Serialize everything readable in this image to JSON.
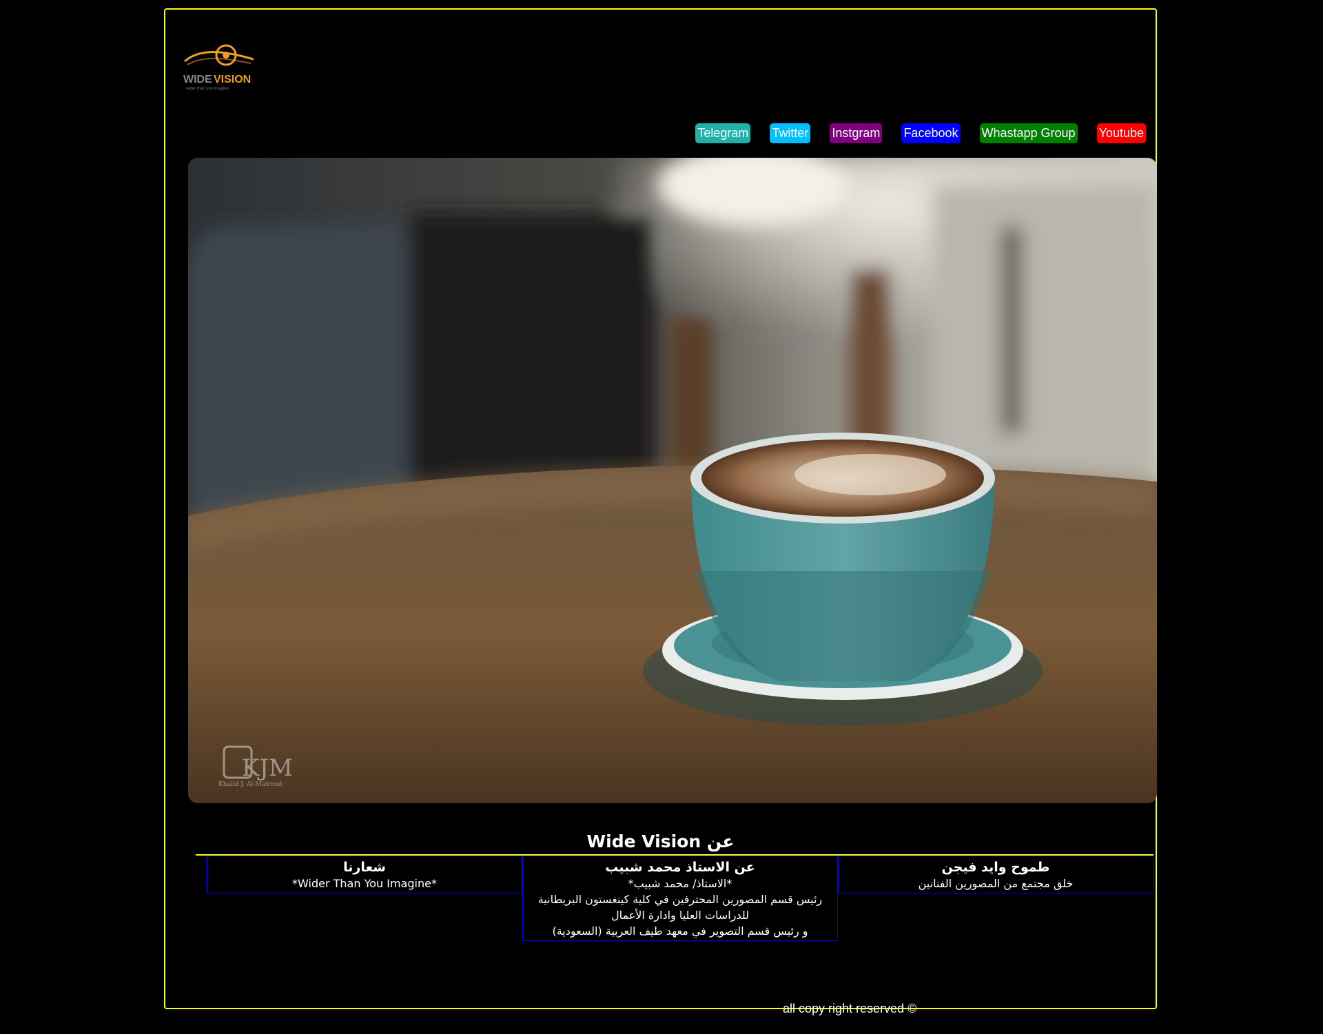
{
  "logo": {
    "brand_part1": "WIDE",
    "brand_part2": "VISION",
    "tagline": "wider than you imagine"
  },
  "nav": {
    "items": [
      {
        "label": "Telegram",
        "color": "#20b2aa"
      },
      {
        "label": "Twitter",
        "color": "#00bfff"
      },
      {
        "label": "Instgram",
        "color": "#800080"
      },
      {
        "label": "Facebook",
        "color": "#0000ff"
      },
      {
        "label": "Whastapp Group",
        "color": "#008000"
      },
      {
        "label": "Youtube",
        "color": "#ff0000"
      }
    ]
  },
  "hero": {
    "watermark_initials": "KJM",
    "watermark_name": "Khalid J. Al-Matrood"
  },
  "about": {
    "title": "عن Wide Vision",
    "columns": [
      {
        "heading": "طموح وايد فيجن",
        "lines": [
          "خلق مجتمع من المصورين الفنانين"
        ]
      },
      {
        "heading": "عن الاستاذ محمد شبيب",
        "lines": [
          "*الاستاذ/ محمد شبيب*",
          "رئيس قسم المصورين المحترفين في كلية كينغستون البريطانية",
          "للدراسات العليا وادارة الأعمال",
          "و رئيس قسم التصوير في معهد طيف العربية (السعودية)"
        ]
      },
      {
        "heading": "شعارنا",
        "lines": [
          "*Wider Than You Imagine*"
        ]
      }
    ]
  },
  "footer": {
    "text": "all copy right reserved ©"
  },
  "colors": {
    "frame_border": "#ffff00",
    "column_border": "#0000ff",
    "logo_orange": "#f0a020"
  }
}
